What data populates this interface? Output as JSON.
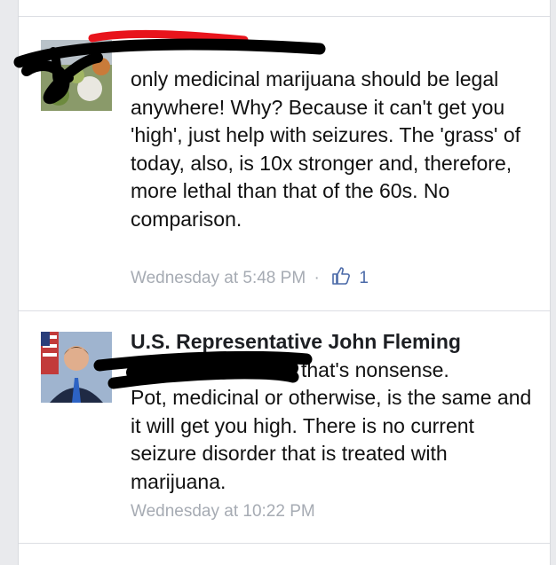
{
  "comments": [
    {
      "author": "",
      "text": "only medicinal marijuana should be legal anywhere! Why? Because it can't get you 'high', just help with seizures. The 'grass' of today, also, is 10x stronger and, therefore, more lethal than that of the 60s. No comparison.",
      "timestamp": "Wednesday at 5:48 PM",
      "separator": "·",
      "like_icon": "thumbs-up-icon",
      "likes": "1",
      "redacted": true
    },
    {
      "author": "U.S. Representative John Fleming",
      "reply_suffix": "that's nonsense.",
      "text": "Pot, medicinal or otherwise, is the same and it will get you high. There is no current seizure disorder that is treated with marijuana.",
      "timestamp": "Wednesday at 10:22 PM",
      "mention_redacted": true
    }
  ],
  "colors": {
    "background": "#e9eaed",
    "text": "#111111",
    "timestamp": "#a6abb3",
    "like_blue": "#4b6aa8",
    "redaction_black": "#000000",
    "redaction_red": "#e8141c"
  }
}
